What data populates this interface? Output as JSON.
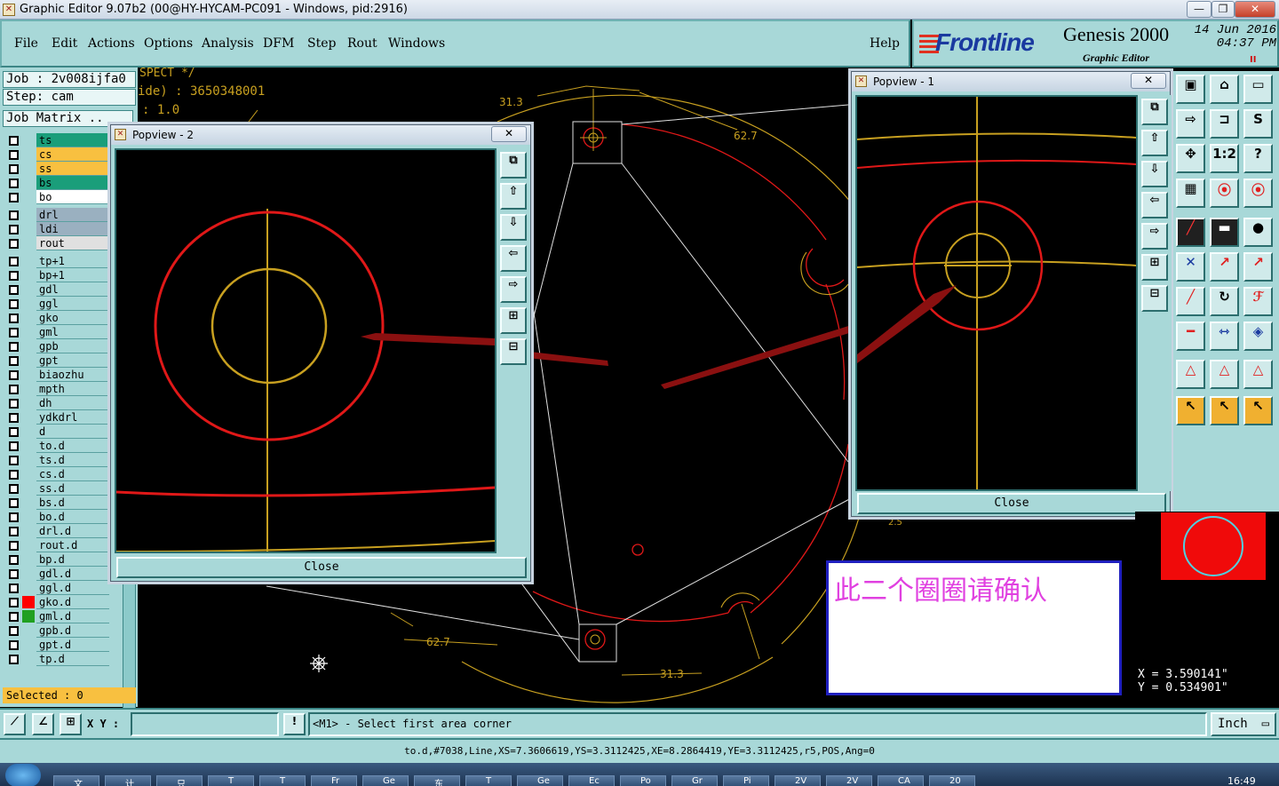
{
  "window": {
    "title": "Graphic Editor 9.07b2 (00@HY-HYCAM-PC091 - Windows, pid:2916)",
    "min": "—",
    "max": "❐",
    "close": "✕"
  },
  "menu": {
    "items": [
      "File",
      "Edit",
      "Actions",
      "Options",
      "Analysis",
      "DFM",
      "Step",
      "Rout",
      "Windows"
    ],
    "help": "Help"
  },
  "brand": {
    "logo": "Frontline",
    "product": "Genesis 2000",
    "sub": "Graphic Editor",
    "date": "14 Jun 2016",
    "time": "04:37 PM",
    "rec": "II"
  },
  "left": {
    "job": "Job : 2v008ijfa0",
    "step": "Step: cam",
    "matrix": "Job Matrix ..",
    "selected": "Selected : 0"
  },
  "layers": [
    {
      "name": "ts",
      "color": "#1a9e7a"
    },
    {
      "name": "cs",
      "color": "#f8c040"
    },
    {
      "name": "ss",
      "color": "#f8c040"
    },
    {
      "name": "bs",
      "color": "#1a9e7a"
    },
    {
      "name": "bo",
      "color": "#ffffff"
    },
    {
      "name": "drl",
      "color": "#9ab0c0"
    },
    {
      "name": "ldi",
      "color": "#9ab0c0"
    },
    {
      "name": "rout",
      "color": "#e0e0e0"
    },
    {
      "name": "tp+1",
      "color": ""
    },
    {
      "name": "bp+1",
      "color": ""
    },
    {
      "name": "gdl",
      "color": ""
    },
    {
      "name": "ggl",
      "color": ""
    },
    {
      "name": "gko",
      "color": ""
    },
    {
      "name": "gml",
      "color": ""
    },
    {
      "name": "gpb",
      "color": ""
    },
    {
      "name": "gpt",
      "color": ""
    },
    {
      "name": "biaozhu",
      "color": ""
    },
    {
      "name": "mpth",
      "color": ""
    },
    {
      "name": "dh",
      "color": ""
    },
    {
      "name": "ydkdrl",
      "color": ""
    },
    {
      "name": "d",
      "color": ""
    },
    {
      "name": "to.d",
      "color": ""
    },
    {
      "name": "ts.d",
      "color": ""
    },
    {
      "name": "cs.d",
      "color": ""
    },
    {
      "name": "ss.d",
      "color": ""
    },
    {
      "name": "bs.d",
      "color": ""
    },
    {
      "name": "bo.d",
      "color": ""
    },
    {
      "name": "drl.d",
      "color": ""
    },
    {
      "name": "rout.d",
      "color": ""
    },
    {
      "name": "bp.d",
      "color": ""
    },
    {
      "name": "gdl.d",
      "color": ""
    },
    {
      "name": "ggl.d",
      "color": ""
    },
    {
      "name": "gko.d",
      "color": "#ff0000"
    },
    {
      "name": "gml.d",
      "color": "#20a020"
    },
    {
      "name": "gpb.d",
      "color": ""
    },
    {
      "name": "gpt.d",
      "color": ""
    },
    {
      "name": "tp.d",
      "color": ""
    }
  ],
  "canvas": {
    "dim_top": "31.3",
    "dim_right": "62.7",
    "dim_left": "62.7",
    "dim_bottom": "31.3",
    "overlay_line1": "SPECT */",
    "overlay_line2": "ide) : 3650348001",
    "overlay_line3": ": 1.0",
    "small_dim": "2.5"
  },
  "popup1": {
    "title": "Popview - 1",
    "close_label": "Close"
  },
  "popup2": {
    "title": "Popview - 2",
    "close_label": "Close"
  },
  "note": {
    "text": "此二个圈圈请确认"
  },
  "coords": {
    "x": "X = 3.590141\"",
    "y": "Y = 0.534901\""
  },
  "cmd": {
    "xy_label": "X Y :",
    "xy_value": "",
    "prompt": "<M1> - Select first area corner",
    "units": "Inch",
    "info": "to.d,#7038,Line,XS=7.3606619,YS=3.3112425,XE=8.2864419,YE=3.3112425,r5,POS,Ang=0"
  },
  "colors": {
    "panel": "#a8d8d8",
    "profile": "#c8a020",
    "outline": "#e01818",
    "marker": "#8a1010"
  },
  "taskbar": {
    "clock": "16:49",
    "tasks": [
      "文",
      "计",
      "只",
      "T",
      "T",
      "Fr",
      "Ge",
      "东",
      "T",
      "Ge",
      "Ec",
      "Po",
      "Gr",
      "Pi",
      "2V",
      "2V",
      "CA",
      "20"
    ]
  }
}
